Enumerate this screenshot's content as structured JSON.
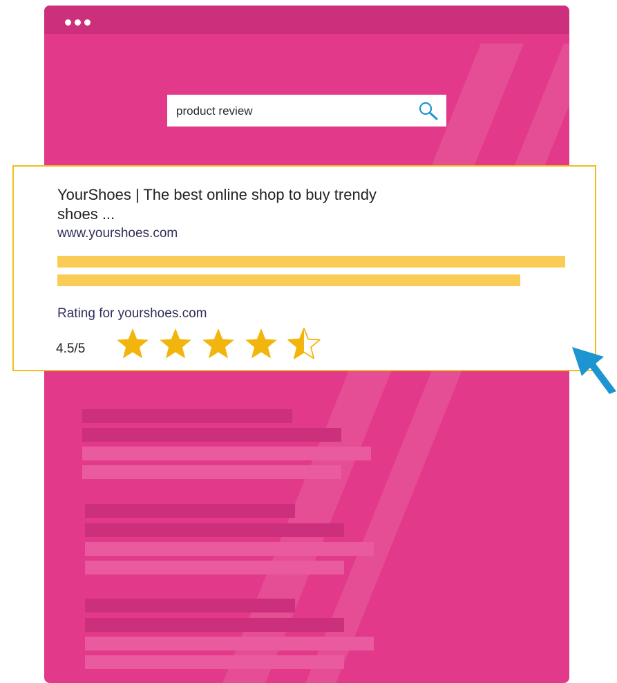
{
  "window": {
    "menu_icon": "three-dots-icon",
    "colors": {
      "background": "#e2398a",
      "titlebar": "#cc2f7c"
    }
  },
  "search": {
    "query": "product review",
    "icon": "search-icon",
    "icon_color": "#1d95d0"
  },
  "result": {
    "title": "YourShoes | The best online shop to buy trendy shoes ...",
    "url": "www.yourshoes.com",
    "rating_label": "Rating for yourshoes.com",
    "rating_text": "4.5/5",
    "rating_value": 4.5,
    "rating_max": 5,
    "star_color": "#f2b50e",
    "border_color": "#f2bc1b"
  },
  "cursor": {
    "icon": "arrow-cursor-icon",
    "color": "#1d95d0"
  }
}
